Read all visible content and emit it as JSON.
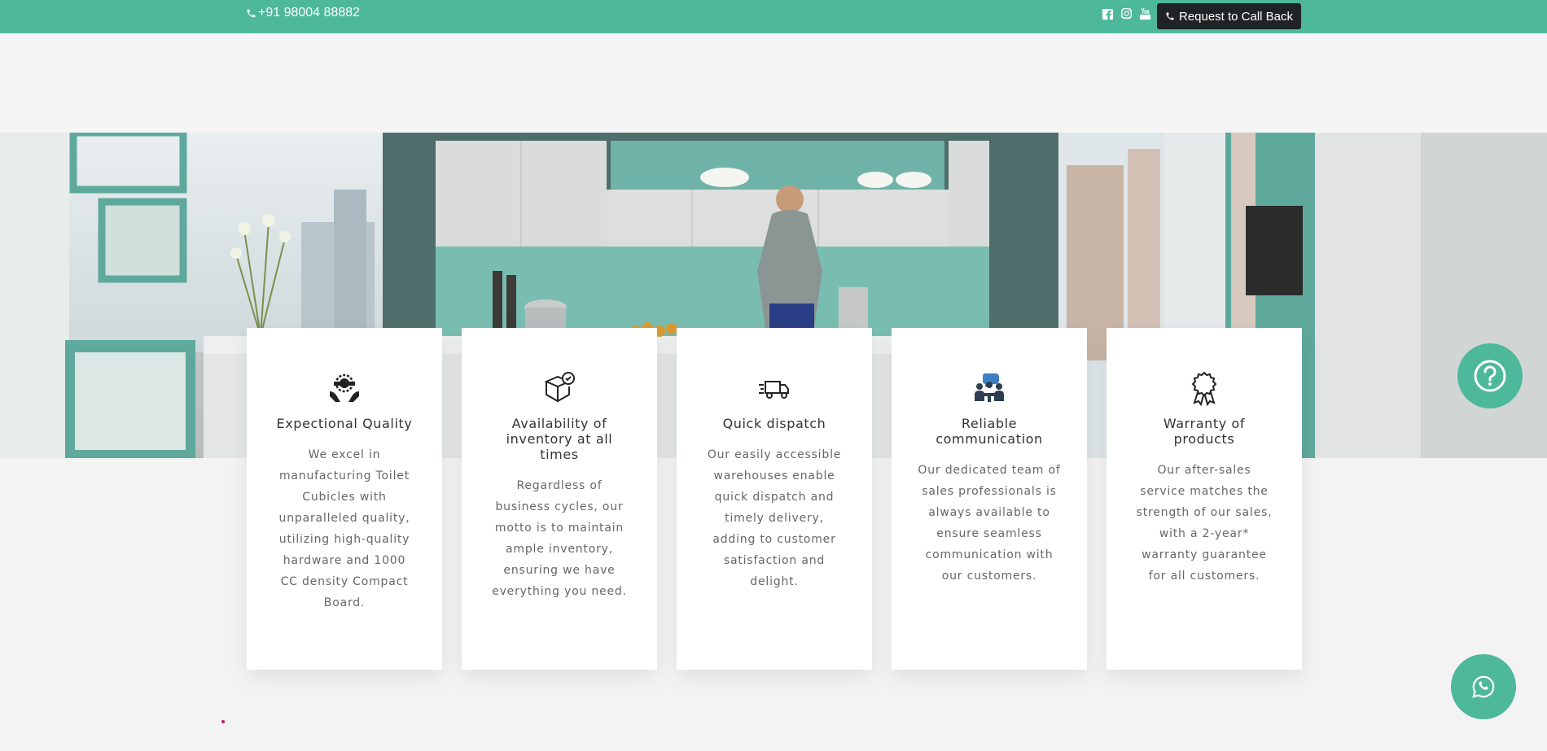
{
  "topbar": {
    "phone": "+91 98004 88882",
    "socials": [
      "facebook-icon",
      "instagram-icon",
      "youtube-icon"
    ],
    "callback_label": "Request to Call Back"
  },
  "colors": {
    "accent": "#4db89a",
    "dark": "#1f2326"
  },
  "features": [
    {
      "icon": "quality-hands-icon",
      "title": "Expectional Quality",
      "text": "We excel in manufacturing Toilet Cubicles with unparalleled quality, utilizing high-quality hardware and 1000 CC density Compact Board."
    },
    {
      "icon": "box-check-icon",
      "title": "Availability of inventory at all times",
      "text": "Regardless of business cycles, our motto is to maintain ample inventory, ensuring we have everything you need."
    },
    {
      "icon": "delivery-truck-icon",
      "title": "Quick dispatch",
      "text": "Our easily accessible warehouses enable quick dispatch and timely delivery, adding to customer satisfaction and delight."
    },
    {
      "icon": "team-communication-icon",
      "title": "Reliable communication",
      "text": "Our dedicated team of sales professionals is always available to ensure seamless communication with our customers."
    },
    {
      "icon": "warranty-badge-icon",
      "title": "Warranty of products",
      "text": "Our after-sales service matches the strength of our sales, with a 2-year* warranty guarantee for all customers."
    }
  ],
  "floating": {
    "help_icon": "question-icon",
    "chat_icon": "whatsapp-icon"
  }
}
